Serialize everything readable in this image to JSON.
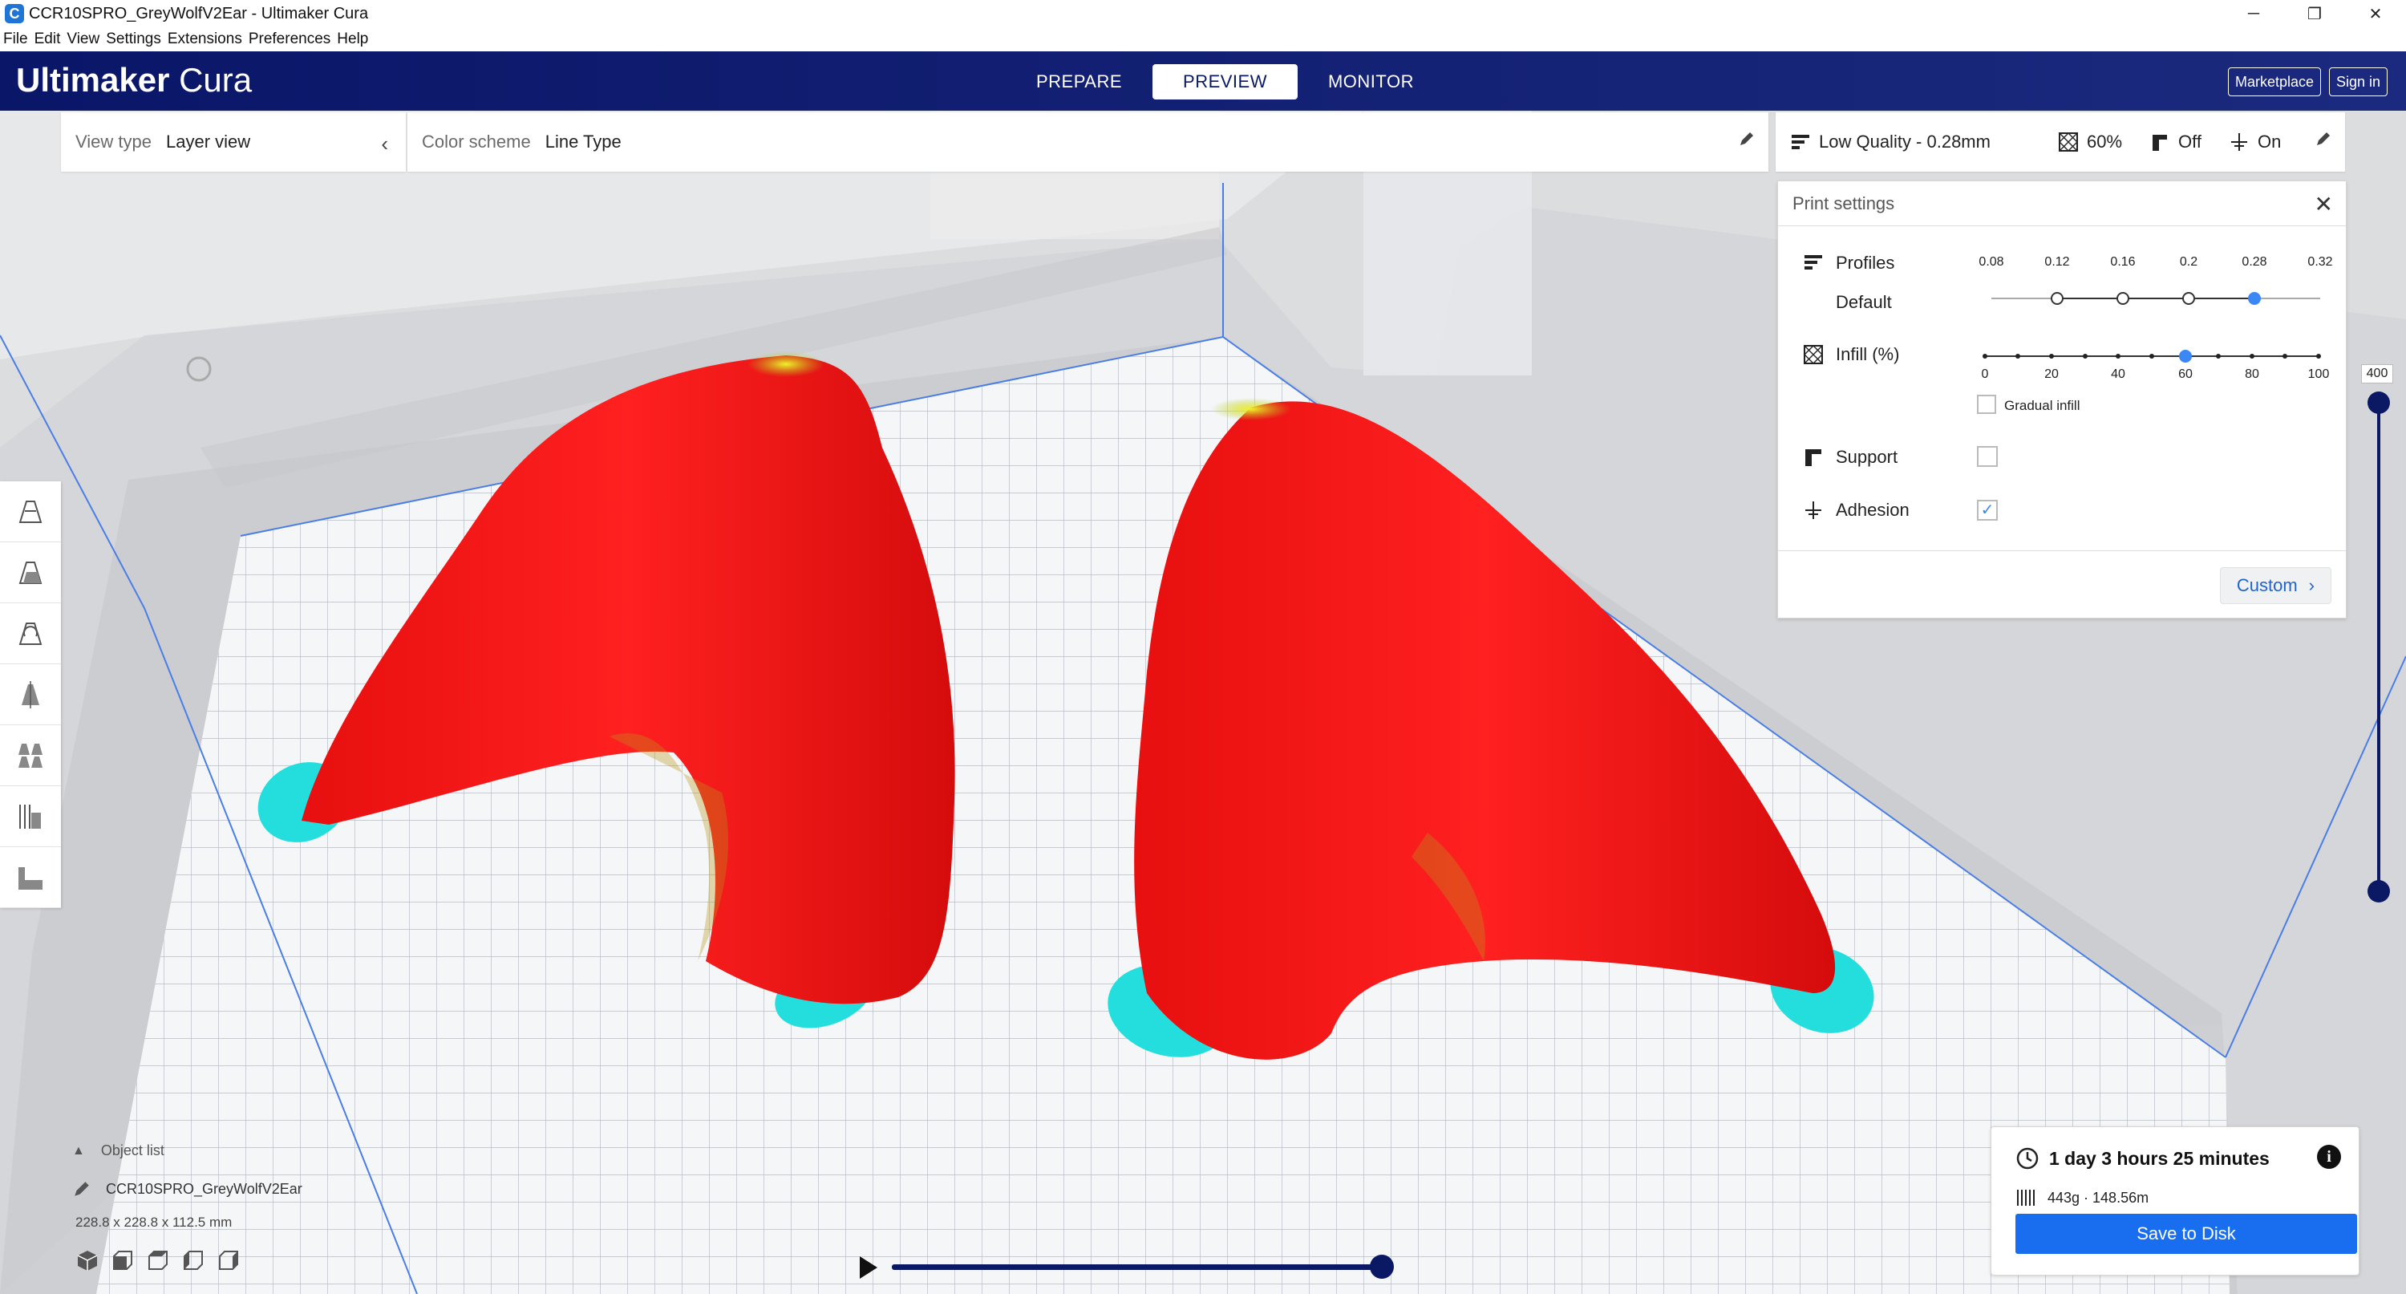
{
  "window": {
    "title": "CCR10SPRO_GreyWolfV2Ear - Ultimaker Cura",
    "icon_letter": "C",
    "controls": [
      "─",
      "❐",
      "✕"
    ]
  },
  "menu": [
    "File",
    "Edit",
    "View",
    "Settings",
    "Extensions",
    "Preferences",
    "Help"
  ],
  "header": {
    "logo_bold": "Ultimaker",
    "logo_light": " Cura",
    "tabs": [
      {
        "label": "PREPARE",
        "active": false
      },
      {
        "label": "PREVIEW",
        "active": true
      },
      {
        "label": "MONITOR",
        "active": false
      }
    ],
    "marketplace": "Marketplace",
    "sign_in": "Sign in"
  },
  "view_bar": {
    "label": "View type",
    "value": "Layer view"
  },
  "color_bar": {
    "label": "Color scheme",
    "value": "Line Type"
  },
  "settings_bar": {
    "profile": "Low Quality - 0.28mm",
    "infill": "60%",
    "support": "Off",
    "adhesion": "On"
  },
  "print_settings": {
    "title": "Print settings",
    "profiles_label": "Profiles",
    "profiles_sub": "Default",
    "profile_ticks": [
      "0.08",
      "0.12",
      "0.16",
      "0.2",
      "0.28",
      "0.32"
    ],
    "profile_selected": "0.28",
    "infill_label": "Infill (%)",
    "infill_ticks": [
      "0",
      "20",
      "40",
      "60",
      "80",
      "100"
    ],
    "infill_value": 60,
    "gradual_label": "Gradual infill",
    "gradual_checked": false,
    "support_label": "Support",
    "support_checked": false,
    "adhesion_label": "Adhesion",
    "adhesion_checked": true,
    "custom_label": "Custom"
  },
  "layer_slider": {
    "max_layer": "400",
    "current_fraction": 1.0
  },
  "object_list": {
    "toggle": "Object list",
    "name": "CCR10SPRO_GreyWolfV2Ear",
    "dims": "228.8 x 228.8 x 112.5 mm"
  },
  "job": {
    "time": "1 day 3 hours 25 minutes",
    "material": "443g · 148.56m",
    "save": "Save to Disk"
  },
  "colors": {
    "header": "#0b1964",
    "accent": "#196ef0",
    "wall_red": "#ff1a1a",
    "skirt_cyan": "#2ee0e0",
    "top_yellow": "#c8e81a"
  }
}
